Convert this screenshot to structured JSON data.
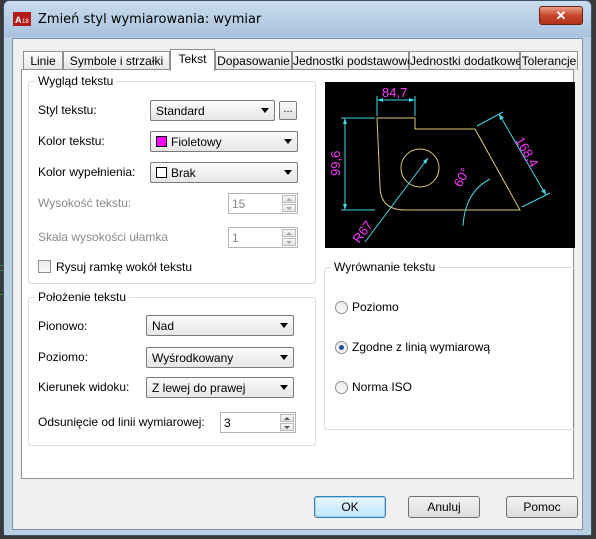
{
  "window": {
    "title": "Zmień styl wymiarowania: wymiar",
    "close_glyph": "✕",
    "app_icon": "autocad-icon"
  },
  "tabs": [
    {
      "label": "Linie",
      "active": false
    },
    {
      "label": "Symbole i strzałki",
      "active": false
    },
    {
      "label": "Tekst",
      "active": true
    },
    {
      "label": "Dopasowanie",
      "active": false
    },
    {
      "label": "Jednostki podstawowe",
      "active": false
    },
    {
      "label": "Jednostki dodatkowe",
      "active": false
    },
    {
      "label": "Tolerancje",
      "active": false
    }
  ],
  "text_appearance": {
    "group_title": "Wygląd tekstu",
    "style_label": "Styl tekstu:",
    "style_value": "Standard",
    "browse_label": "...",
    "color_label": "Kolor tekstu:",
    "color_value": "Fioletowy",
    "color_swatch": "#ff00ff",
    "fill_label": "Kolor wypełnienia:",
    "fill_value": "Brak",
    "fill_swatch": "#ffffff",
    "height_label": "Wysokość tekstu:",
    "height_value": "15",
    "fraction_label": "Skala wysokości ułamka",
    "fraction_value": "1",
    "frame_label": "Rysuj ramkę wokół tekstu",
    "frame_checked": false
  },
  "text_placement": {
    "group_title": "Położenie tekstu",
    "vertical_label": "Pionowo:",
    "vertical_value": "Nad",
    "horizontal_label": "Poziomo:",
    "horizontal_value": "Wyśrodkowany",
    "direction_label": "Kierunek widoku:",
    "direction_value": "Z lewej do prawej",
    "offset_label": "Odsunięcie od linii wymiarowej:",
    "offset_value": "3"
  },
  "text_alignment": {
    "group_title": "Wyrównanie tekstu",
    "options": [
      {
        "label": "Poziomo",
        "selected": false
      },
      {
        "label": "Zgodne z linią wymiarową",
        "selected": true
      },
      {
        "label": "Norma ISO",
        "selected": false
      }
    ]
  },
  "preview": {
    "dim_top": "84,7",
    "dim_left": "99,6",
    "dim_right": "168,4",
    "dim_angle": "60°",
    "dim_radius": "R67",
    "colors": {
      "background": "#000000",
      "geometry": "#e5c76b",
      "dimension": "#3fd7e6",
      "text": "#ff33ff"
    }
  },
  "buttons": {
    "ok": "OK",
    "cancel": "Anuluj",
    "help": "Pomoc"
  }
}
